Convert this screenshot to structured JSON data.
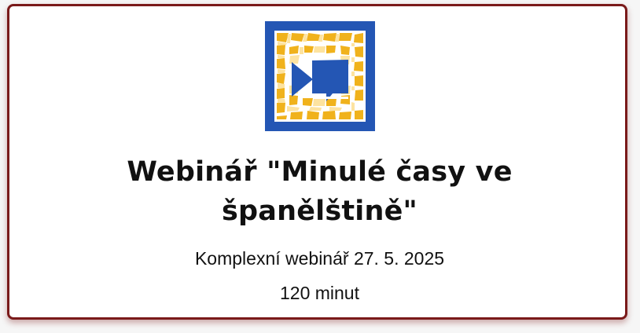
{
  "card": {
    "title": "Webinář \"Minulé časy ve španělštině\"",
    "subtitle": "Komplexní webinář 27. 5. 2025",
    "duration": "120 minut"
  },
  "logo": {
    "icon": "mosaic-video-icon",
    "colors": {
      "frame": "#2456b4",
      "mosaic_dark": "#f0b21c",
      "mosaic_light": "#fde3a0",
      "border": "#7a1a1a"
    }
  }
}
